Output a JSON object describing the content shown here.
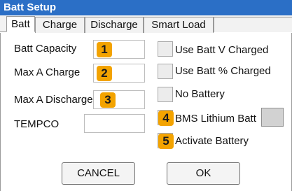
{
  "window": {
    "title": "Batt Setup"
  },
  "tabs": [
    "Batt",
    "Charge",
    "Discharge",
    "Smart Load"
  ],
  "fields": {
    "batt_capacity": {
      "label": "Batt Capacity",
      "badge": "1",
      "value": ""
    },
    "max_a_charge": {
      "label": "Max A Charge",
      "badge": "2",
      "value": ""
    },
    "max_a_discharge": {
      "label": "Max A Discharge",
      "badge": "3",
      "value": ""
    },
    "tempco": {
      "label": "TEMPCO",
      "value": ""
    }
  },
  "checkboxes": {
    "use_batt_v_charged": {
      "label": "Use Batt V Charged"
    },
    "use_batt_pct_charged": {
      "label": "Use Batt % Charged"
    },
    "no_battery": {
      "label": "No Battery"
    },
    "bms_lithium_batt": {
      "label": "BMS Lithium Batt",
      "badge": "4"
    },
    "activate_battery": {
      "label": "Activate Battery",
      "badge": "5"
    }
  },
  "buttons": {
    "cancel": "CANCEL",
    "ok": "OK"
  },
  "colors": {
    "titlebar": "#2b6fc6",
    "badge": "#f3a300"
  }
}
